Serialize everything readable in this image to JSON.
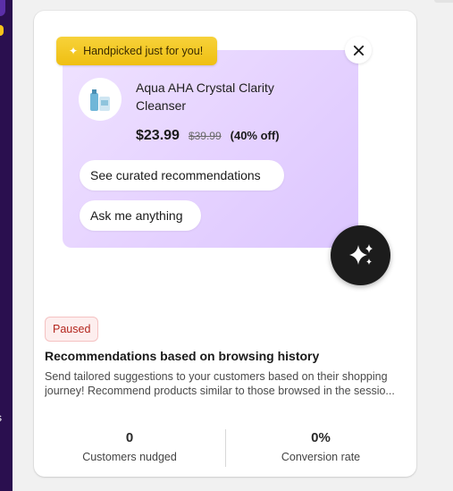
{
  "sidebar": {
    "cut_text": "s",
    "badge_color": "#f6c21a",
    "bg_color": "#2a0f4f"
  },
  "card": {
    "preview": {
      "handpicked_label": "Handpicked just for you!",
      "handpicked_icon": "sparkle-icon",
      "close_icon": "close-icon",
      "product": {
        "name": "Aqua AHA Crystal Clarity Cleanser",
        "price": "$23.99",
        "original_price": "$39.99",
        "discount": "(40% off)"
      },
      "chips": [
        "See curated recommendations",
        "Ask me anything"
      ],
      "fab_icon": "sparkle-icon"
    },
    "status": "Paused",
    "title": "Recommendations based on browsing history",
    "description_line1": "Send tailored suggestions to your customers based on their shopping",
    "description_line2": "journey! Recommend products similar to those browsed in the sessio...",
    "stats": [
      {
        "value": "0",
        "label": "Customers nudged"
      },
      {
        "value": "0%",
        "label": "Conversion rate"
      }
    ]
  },
  "colors": {
    "accent_yellow": "#efbf12",
    "bubble_purple": "#e6d3ff",
    "paused_red": "#b3261e"
  }
}
